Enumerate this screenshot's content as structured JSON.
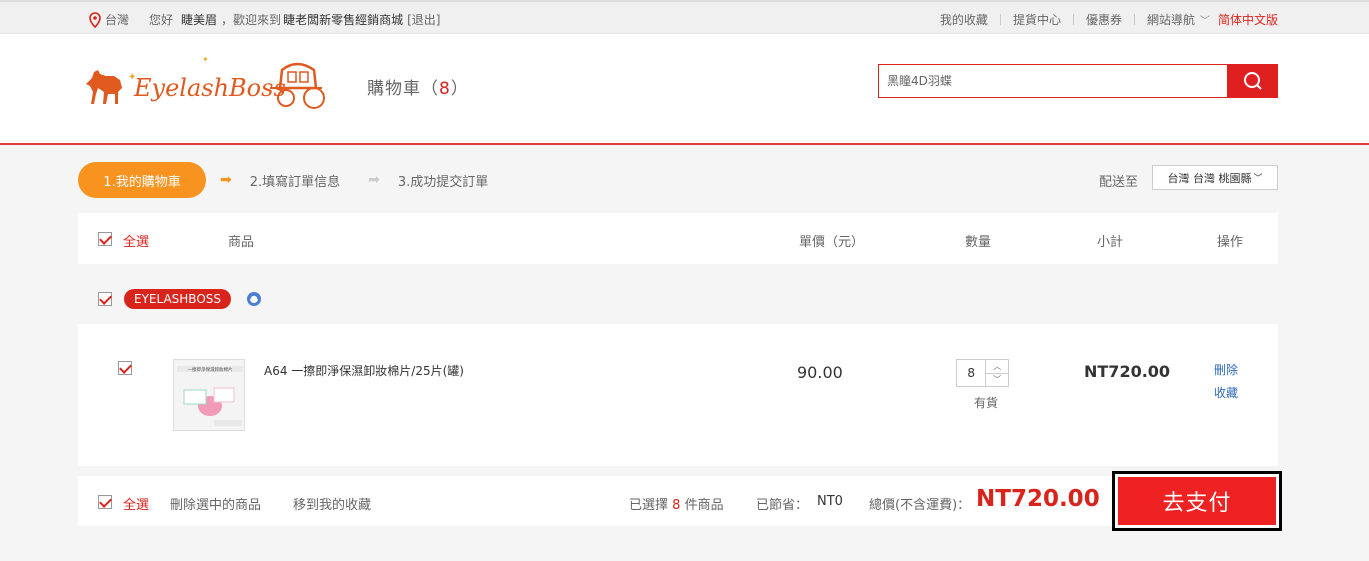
{
  "topbar": {
    "location": "台灣",
    "greeting": "您好",
    "user": "睫美眉",
    "welcome": "，歡迎來到",
    "store": "睫老闆新零售經銷商城",
    "logout": "[退出]",
    "links": [
      "我的收藏",
      "提貨中心",
      "優惠券",
      "網站導航"
    ],
    "language": "简体中文版"
  },
  "header": {
    "logo_text": "EyelashBoss",
    "cart_label": "購物車（",
    "cart_count": "8",
    "cart_close": "）",
    "search_placeholder": "黑瞳4D羽蝶"
  },
  "steps": {
    "step1": "1.我的購物車",
    "step2": "2.填寫訂單信息",
    "step3": "3.成功提交訂單"
  },
  "shipping": {
    "label": "配送至",
    "region": "台灣 台灣 桃園縣"
  },
  "table_header": {
    "select_all": "全選",
    "product": "商品",
    "unit_price": "單價（元）",
    "quantity": "數量",
    "subtotal": "小計",
    "action": "操作"
  },
  "shop": {
    "name": "EYELASHBOSS"
  },
  "item": {
    "thumb_caption": "一擦即淨保濕卸妝棉片",
    "title": "A64 一擦即淨保濕卸妝棉片/25片(罐)",
    "price": "90.00",
    "qty": "8",
    "stock": "有貨",
    "subtotal": "NT720.00",
    "delete": "刪除",
    "favorite": "收藏"
  },
  "footer": {
    "select_all": "全選",
    "delete_selected": "刪除選中的商品",
    "move_to_fav": "移到我的收藏",
    "selected_prefix": "已選擇",
    "selected_count": "8",
    "selected_suffix": "件商品",
    "saved_label": "已節省：",
    "saved_value": "NT0",
    "total_label": "總價(不含運費)：",
    "total_value": "NT720.00",
    "pay_button": "去支付"
  },
  "colors": {
    "accent_red": "#d9241c",
    "step_orange": "#f7931e",
    "link_blue": "#2e69b5"
  }
}
